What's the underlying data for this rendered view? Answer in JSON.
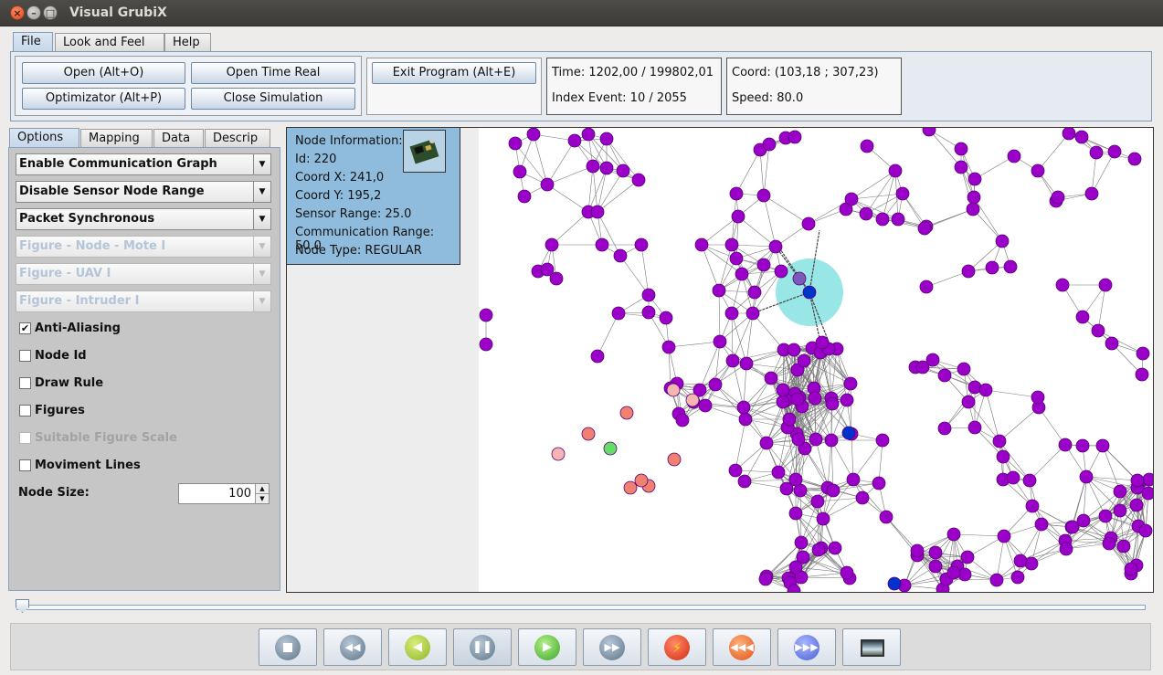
{
  "window": {
    "title": "Visual GrubiX"
  },
  "menu_tabs": [
    "File",
    "Look and Feel",
    "Help"
  ],
  "file_panel": {
    "open": "Open (Alt+O)",
    "open_time_real": "Open Time Real",
    "optimizator": "Optimizator (Alt+P)",
    "close_simulation": "Close Simulation",
    "exit_program": "Exit Program (Alt+E)",
    "time": "Time: 1202,00 / 199802,01",
    "index_event": "Index Event: 10 / 2055",
    "coord": "Coord: (103,18 ; 307,23)",
    "speed": "Speed: 80.0"
  },
  "side_tabs": [
    "Options",
    "Mapping",
    "Data",
    "Descrip"
  ],
  "options": {
    "combos": [
      "Enable Communication Graph",
      "Disable Sensor Node Range",
      "Packet Synchronous"
    ],
    "disabled_combos": [
      "Figure - Node - Mote I",
      "Figure - UAV I",
      "Figure - Intruder I"
    ],
    "checkboxes": [
      {
        "label": "Anti-Aliasing",
        "checked": true,
        "enabled": true
      },
      {
        "label": "Node Id",
        "checked": false,
        "enabled": true
      },
      {
        "label": "Draw Rule",
        "checked": false,
        "enabled": true
      },
      {
        "label": "Figures",
        "checked": false,
        "enabled": true
      },
      {
        "label": "Suitable Figure Scale",
        "checked": false,
        "enabled": false
      },
      {
        "label": "Moviment Lines",
        "checked": false,
        "enabled": true
      }
    ],
    "node_size_label": "Node Size:",
    "node_size_value": "100"
  },
  "node_info": {
    "title": "Node Information:",
    "id": "Id: 220",
    "coord_x": "Coord X: 241,0",
    "coord_y": "Coord Y: 195,2",
    "sensor_range": "Sensor Range: 25.0",
    "comm_range": "Communication Range: 50.0",
    "node_type": "Node Type: REGULAR"
  },
  "colors": {
    "regular_node": "#9a00c8",
    "sink_node": "#0033cc",
    "salmon_node": "#f08070",
    "pink_node": "#f5b5b0",
    "green_node": "#66dd66",
    "range_highlight": "#7fe0e0",
    "info_panel_bg": "#8fbcdc"
  },
  "controls": [
    "stop-icon",
    "skip-back-icon",
    "step-back-icon",
    "pause-icon",
    "play-icon",
    "skip-forward-icon",
    "flash-icon",
    "rewind-icon",
    "fast-forward-icon",
    "screenshot-icon"
  ]
}
